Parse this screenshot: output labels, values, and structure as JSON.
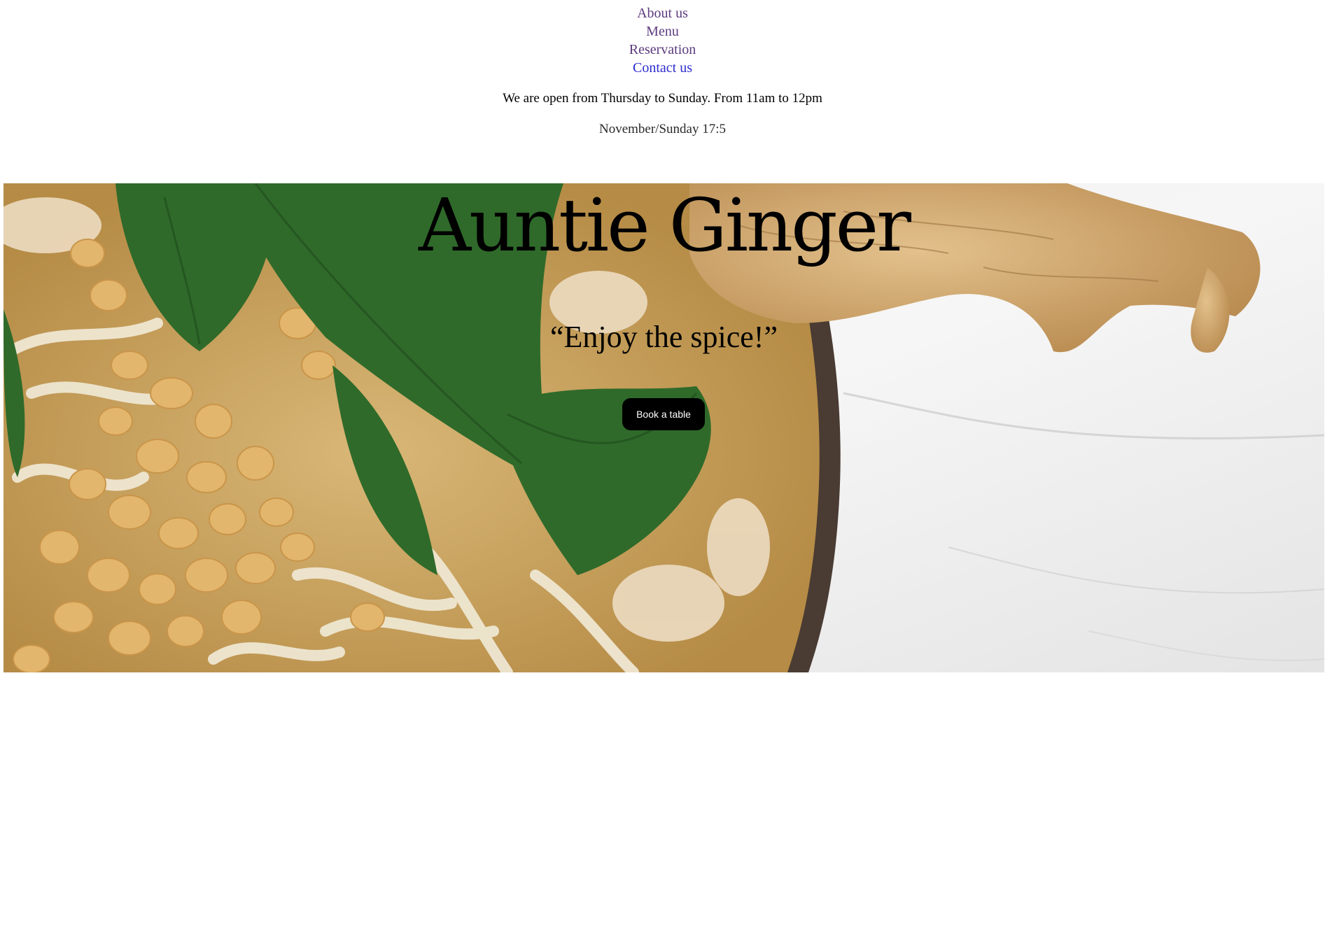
{
  "nav": {
    "items": [
      {
        "label": "About us",
        "state": "visited"
      },
      {
        "label": "Menu",
        "state": "visited"
      },
      {
        "label": "Reservation",
        "state": "visited"
      },
      {
        "label": "Contact us",
        "state": "unvisited"
      }
    ]
  },
  "info": {
    "hours": "We are open from Thursday to Sunday. From 11am to 12pm",
    "datetime": "November/Sunday 17:5"
  },
  "hero": {
    "title": "Auntie Ginger",
    "tagline": "“Enjoy the spice!”",
    "cta_label": "Book a table"
  },
  "colors": {
    "link_visited": "#5c3a7e",
    "link_unvisited": "#2b2bcf",
    "button_bg": "#000000",
    "button_text": "#ffffff"
  }
}
